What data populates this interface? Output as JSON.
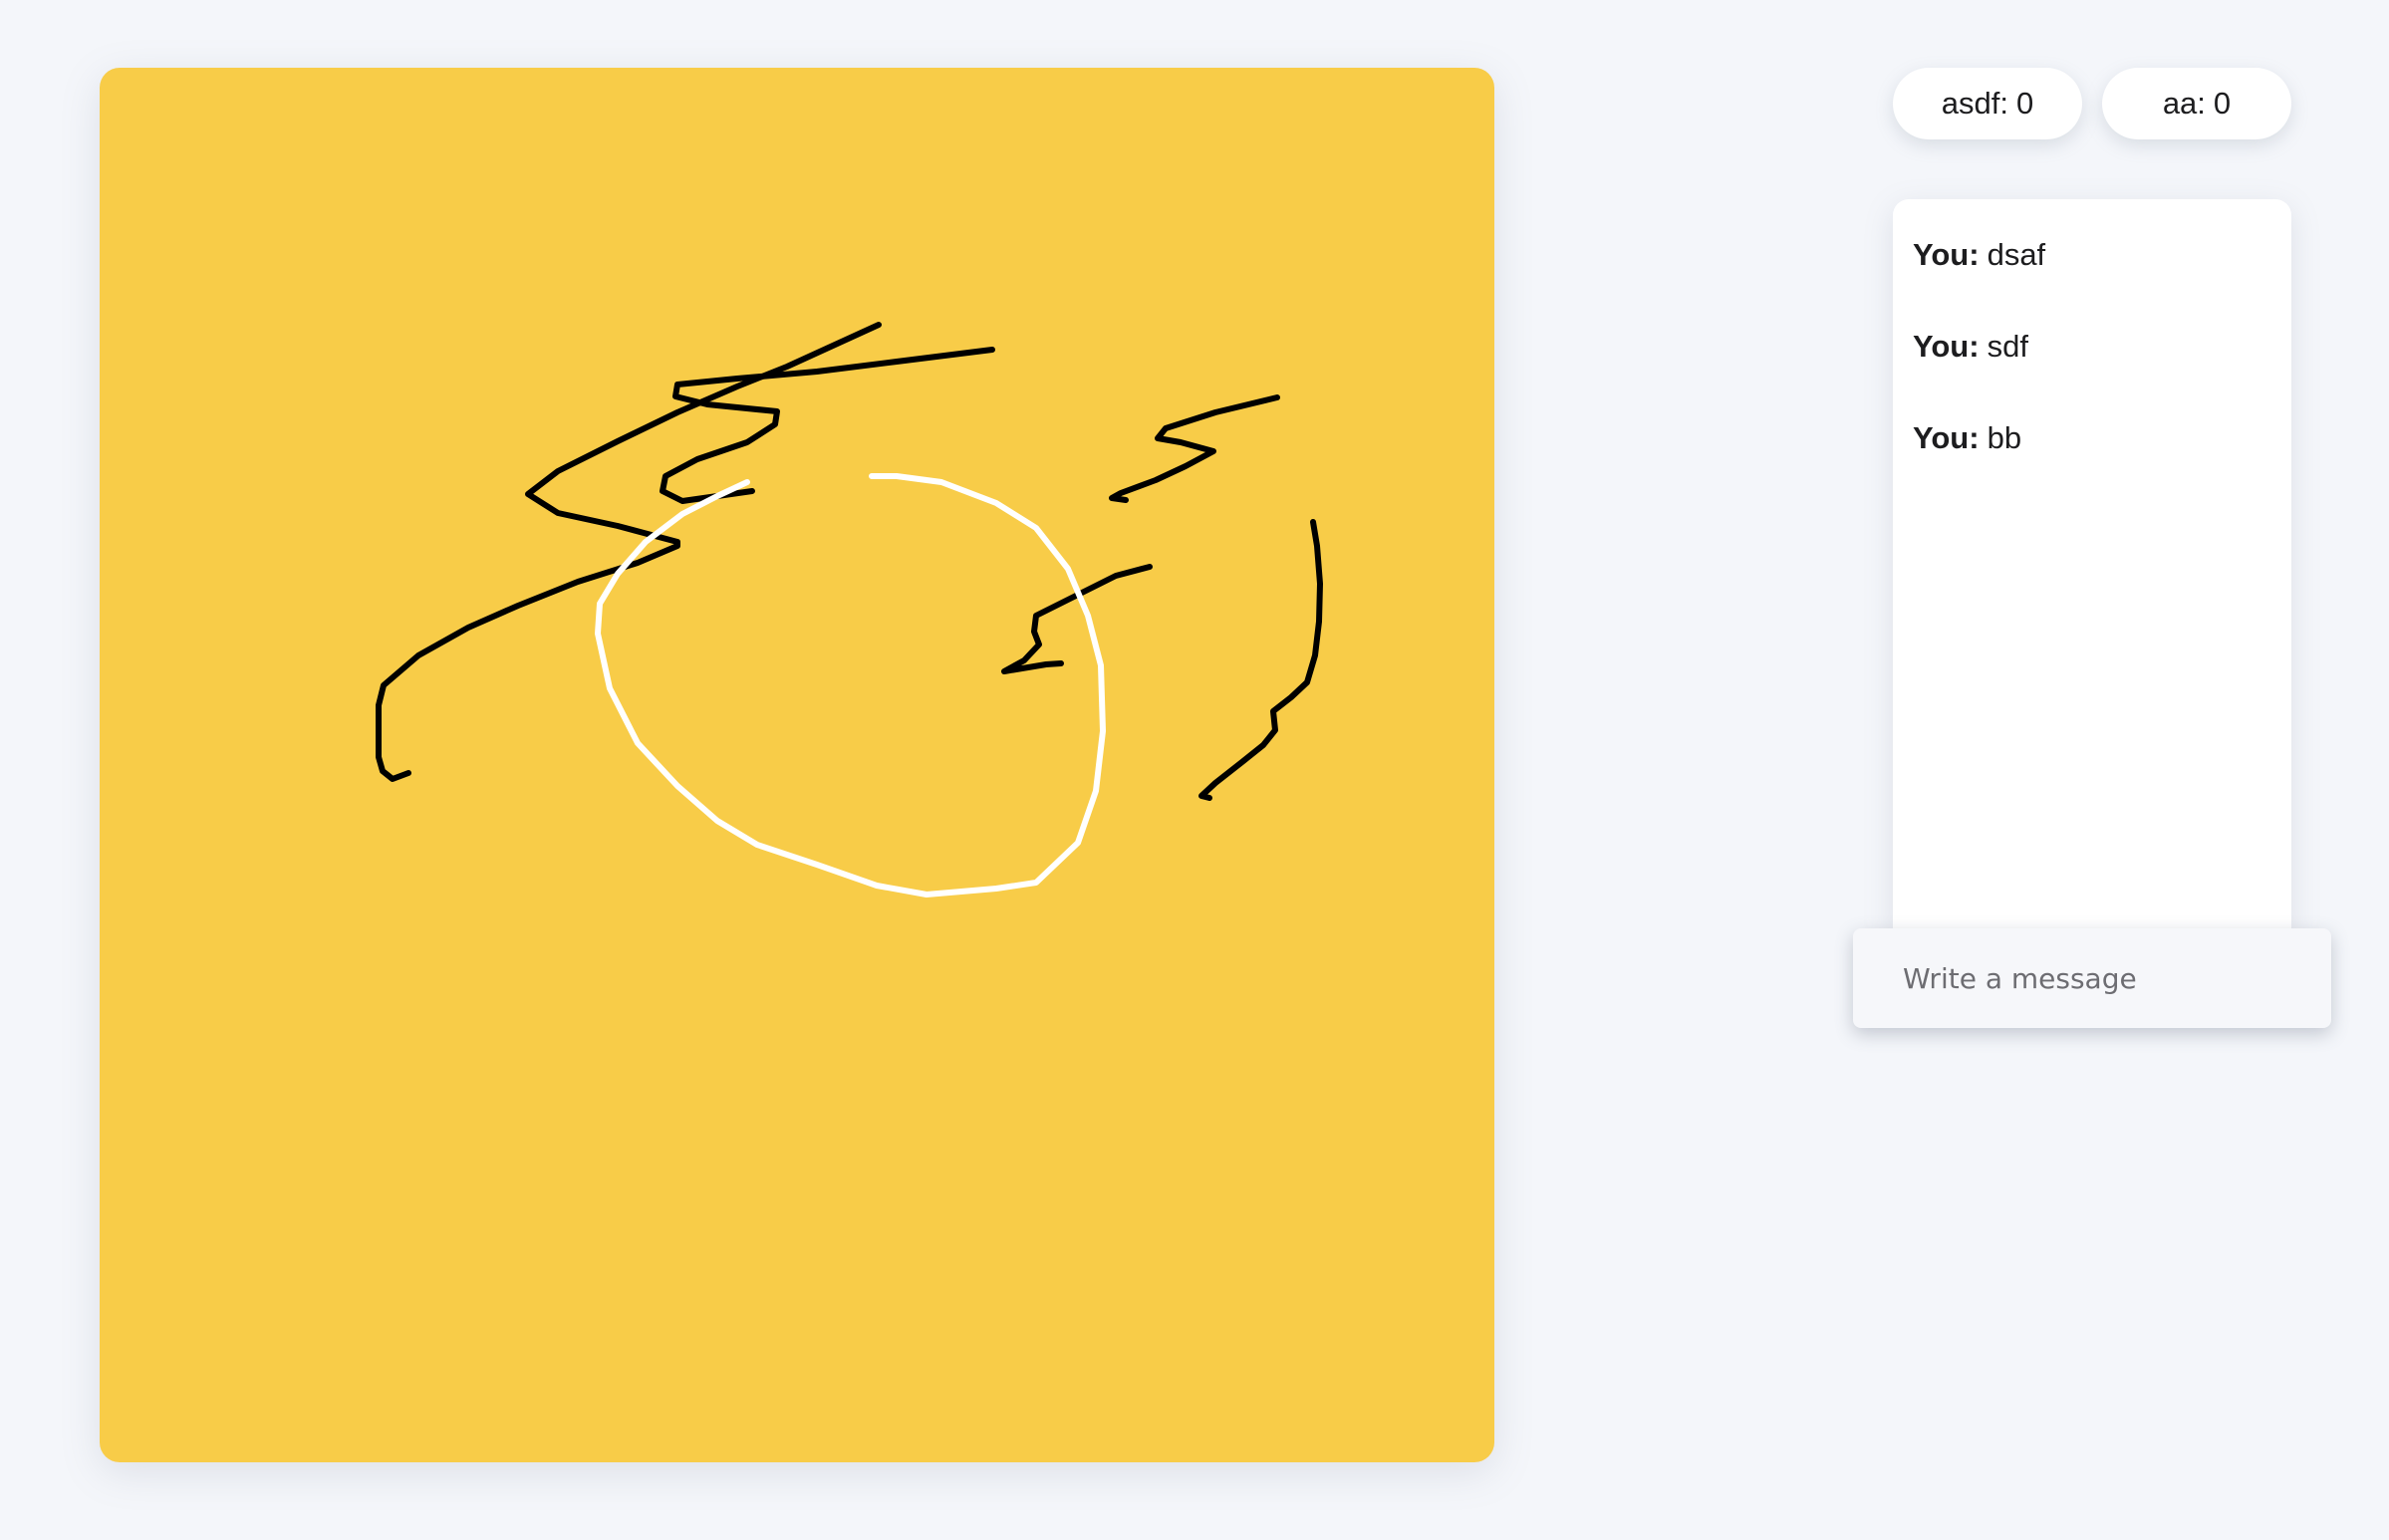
{
  "canvas": {
    "background": "#f8cc48",
    "stroke_colors": [
      "#000000",
      "#ffffff"
    ]
  },
  "scores": [
    {
      "name": "asdf",
      "score": "0"
    },
    {
      "name": "aa",
      "score": "0"
    }
  ],
  "chat": {
    "messages": [
      {
        "author": "You:",
        "text": "dsaf"
      },
      {
        "author": "You:",
        "text": "sdf"
      },
      {
        "author": "You:",
        "text": "bb"
      }
    ],
    "input_placeholder": "Write a message",
    "input_value": ""
  }
}
